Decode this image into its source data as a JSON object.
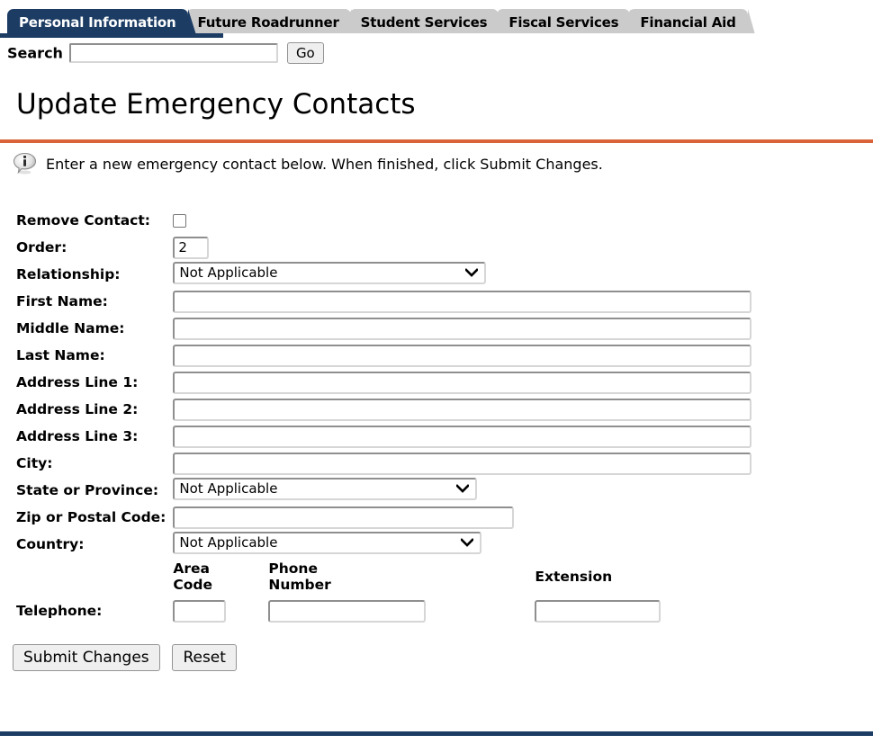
{
  "colors": {
    "active_tab_bg": "#1c3c64",
    "inactive_tab_bg": "#cbcbcb",
    "orange_rule": "#d9633a",
    "navy_rule": "#1c3c64"
  },
  "tabs": [
    {
      "label": "Personal Information",
      "active": true
    },
    {
      "label": "Future Roadrunner",
      "active": false
    },
    {
      "label": "Student Services",
      "active": false
    },
    {
      "label": "Fiscal Services",
      "active": false
    },
    {
      "label": "Financial Aid",
      "active": false
    }
  ],
  "search": {
    "label": "Search",
    "value": "",
    "placeholder": "",
    "go_label": "Go"
  },
  "page": {
    "title": "Update Emergency Contacts",
    "info_icon": "info-bubble-icon",
    "info_message": "Enter a new emergency contact below. When finished, click Submit Changes."
  },
  "form": {
    "remove_contact": {
      "label": "Remove Contact:",
      "checked": false
    },
    "order": {
      "label": "Order:",
      "value": "2"
    },
    "relationship": {
      "label": "Relationship:",
      "value": "Not Applicable"
    },
    "first_name": {
      "label": "First Name:",
      "value": ""
    },
    "middle_name": {
      "label": "Middle Name:",
      "value": ""
    },
    "last_name": {
      "label": "Last Name:",
      "value": ""
    },
    "address_line_1": {
      "label": "Address Line 1:",
      "value": ""
    },
    "address_line_2": {
      "label": "Address Line 2:",
      "value": ""
    },
    "address_line_3": {
      "label": "Address Line 3:",
      "value": ""
    },
    "city": {
      "label": "City:",
      "value": ""
    },
    "state": {
      "label": "State or Province:",
      "value": "Not Applicable"
    },
    "zip": {
      "label": "Zip or Postal Code:",
      "value": ""
    },
    "country": {
      "label": "Country:",
      "value": "Not Applicable"
    },
    "telephone": {
      "label": "Telephone:",
      "area_code_header_line1": "Area",
      "area_code_header_line2": "Code",
      "phone_number_header_line1": "Phone",
      "phone_number_header_line2": "Number",
      "extension_header": "Extension",
      "area_code_value": "",
      "phone_number_value": "",
      "extension_value": ""
    }
  },
  "buttons": {
    "submit": "Submit Changes",
    "reset": "Reset"
  }
}
